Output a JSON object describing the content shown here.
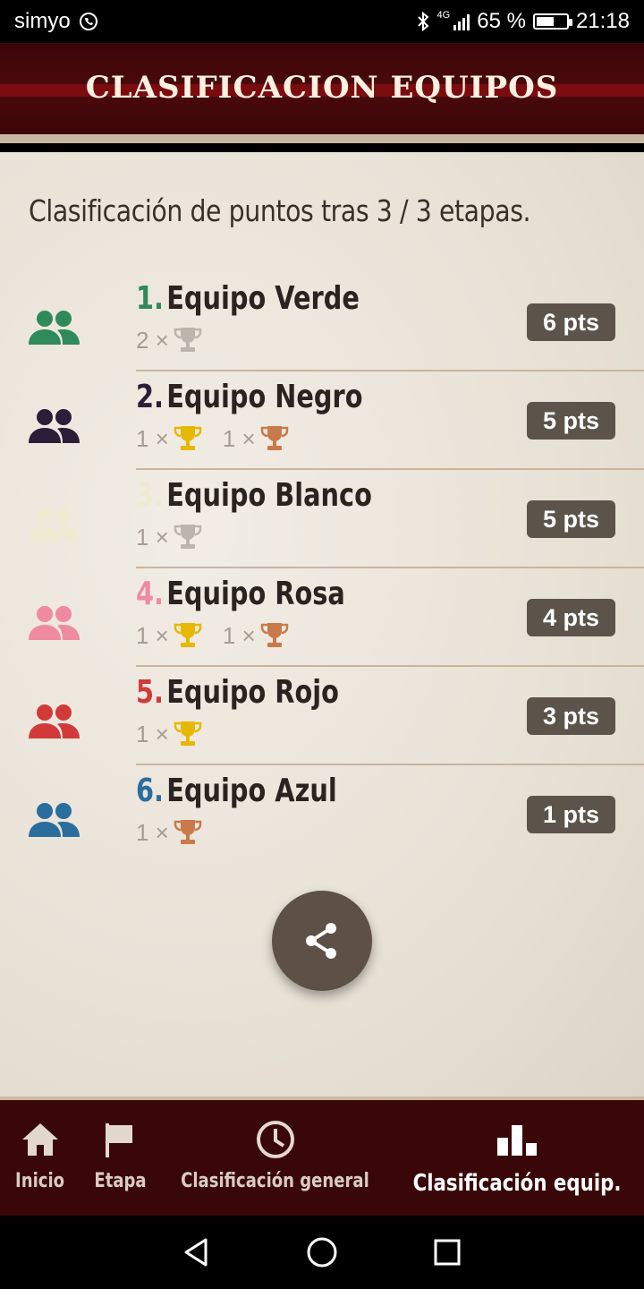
{
  "status_bar": {
    "carrier": "simyo",
    "network": "4G",
    "battery": "65 %",
    "battery_level": 0.65,
    "time": "21:18"
  },
  "header": {
    "title": "CLASIFICACION EQUIPOS"
  },
  "main": {
    "subtitle": "Clasificación de puntos tras 3 / 3 etapas.",
    "teams": [
      {
        "rank": "1.",
        "name": "Equipo Verde",
        "color": "#2e8a5a",
        "points": "6 pts",
        "trophies": [
          {
            "count": "2 ×",
            "icon": "silver-trophy-icon",
            "color": "#bdb5ad"
          }
        ]
      },
      {
        "rank": "2.",
        "name": "Equipo Negro",
        "color": "#2a1e38",
        "points": "5 pts",
        "trophies": [
          {
            "count": "1 ×",
            "icon": "gold-trophy-icon",
            "color": "#e6b800"
          },
          {
            "count": "1 ×",
            "icon": "bronze-trophy-icon",
            "color": "#c87a4a"
          }
        ]
      },
      {
        "rank": "3.",
        "name": "Equipo Blanco",
        "color": "#efead2",
        "points": "5 pts",
        "trophies": [
          {
            "count": "1 ×",
            "icon": "silver-trophy-icon",
            "color": "#bdb5ad"
          }
        ]
      },
      {
        "rank": "4.",
        "name": "Equipo Rosa",
        "color": "#f08aa0",
        "points": "4 pts",
        "trophies": [
          {
            "count": "1 ×",
            "icon": "gold-trophy-icon",
            "color": "#e6b800"
          },
          {
            "count": "1 ×",
            "icon": "bronze-trophy-icon",
            "color": "#c87a4a"
          }
        ]
      },
      {
        "rank": "5.",
        "name": "Equipo Rojo",
        "color": "#d23a3a",
        "points": "3 pts",
        "trophies": [
          {
            "count": "1 ×",
            "icon": "gold-trophy-icon",
            "color": "#e6b800"
          }
        ]
      },
      {
        "rank": "6.",
        "name": "Equipo Azul",
        "color": "#2a6e9e",
        "points": "1 pts",
        "trophies": [
          {
            "count": "1 ×",
            "icon": "bronze-trophy-icon",
            "color": "#c87a4a"
          }
        ]
      }
    ],
    "share_icon": "share-icon"
  },
  "bottom_nav": {
    "items": [
      {
        "label": "Inicio",
        "icon": "home-icon"
      },
      {
        "label": "Etapa",
        "icon": "flag-icon"
      },
      {
        "label": "Clasificación general",
        "icon": "clock-icon"
      },
      {
        "label": "Clasificación equip.",
        "icon": "podium-icon",
        "active": true
      }
    ]
  },
  "system_nav": {
    "items": [
      "back-icon",
      "home-circle-icon",
      "recents-icon"
    ]
  }
}
